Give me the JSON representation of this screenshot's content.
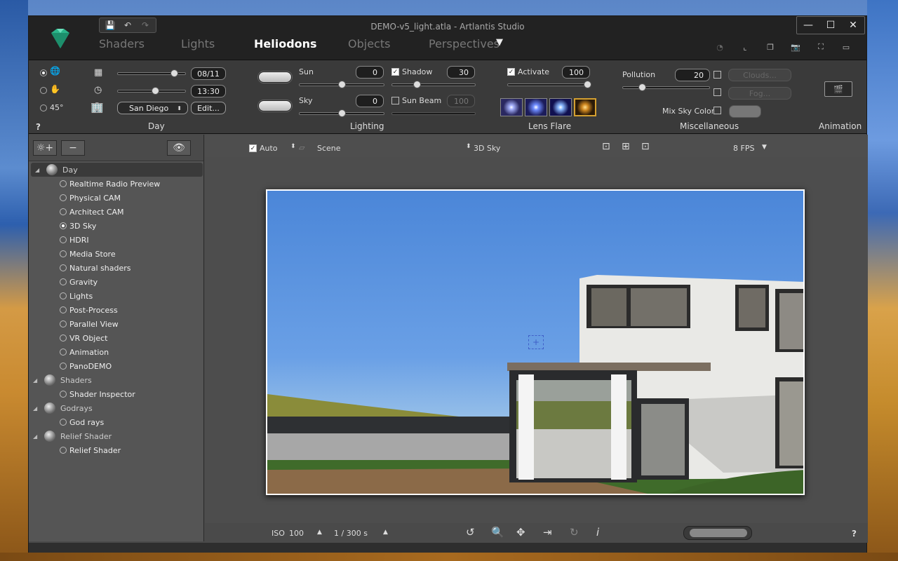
{
  "window": {
    "title": "DEMO-v5_light.atla - Artlantis Studio",
    "controls": {
      "minimize": "—",
      "maximize": "☐",
      "close": "✕"
    }
  },
  "quick_access": [
    "save-icon",
    "undo-icon",
    "redo-icon"
  ],
  "tabs": [
    {
      "label": "Shaders",
      "active": false
    },
    {
      "label": "Lights",
      "active": false
    },
    {
      "label": "Heliodons",
      "active": true
    },
    {
      "label": "Objects",
      "active": false
    },
    {
      "label": "Perspectives",
      "active": false
    }
  ],
  "toolbar_icons": [
    "timer-icon",
    "axis-icon",
    "window-icon",
    "camera-icon",
    "crop-icon",
    "monitor-icon"
  ],
  "day": {
    "label": "Day",
    "date": "08/11",
    "time": "13:30",
    "city": "San Diego",
    "edit_label": "Edit...",
    "angle_label": "45°",
    "date_slider": 0.85,
    "time_slider": 0.55
  },
  "lighting": {
    "label": "Lighting",
    "sun_label": "Sun",
    "sun_value": "0",
    "sky_label": "Sky",
    "sky_value": "0",
    "shadow_label": "Shadow",
    "shadow_checked": true,
    "shadow_value": "30",
    "sunbeam_label": "Sun Beam",
    "sunbeam_checked": false,
    "sunbeam_value": "100"
  },
  "lens_flare": {
    "label": "Lens Flare",
    "activate_label": "Activate",
    "activate_checked": true,
    "value": "100"
  },
  "misc": {
    "label": "Miscellaneous",
    "pollution_label": "Pollution",
    "pollution_value": "20",
    "clouds_label": "Clouds...",
    "fog_label": "Fog...",
    "mix_sky_label": "Mix Sky Color"
  },
  "animation": {
    "label": "Animation"
  },
  "help_label": "?",
  "tree": [
    {
      "label": "Day",
      "type": "group",
      "selected": true
    },
    {
      "label": "Realtime Radio Preview",
      "type": "item",
      "on": false
    },
    {
      "label": "Physical CAM",
      "type": "item",
      "on": false
    },
    {
      "label": "Architect CAM",
      "type": "item",
      "on": false
    },
    {
      "label": "3D Sky",
      "type": "item",
      "on": true
    },
    {
      "label": "HDRI",
      "type": "item",
      "on": false
    },
    {
      "label": "Media Store",
      "type": "item",
      "on": false
    },
    {
      "label": "Natural shaders",
      "type": "item",
      "on": false
    },
    {
      "label": "Gravity",
      "type": "item",
      "on": false
    },
    {
      "label": "Lights",
      "type": "item",
      "on": false
    },
    {
      "label": "Post-Process",
      "type": "item",
      "on": false
    },
    {
      "label": "Parallel View",
      "type": "item",
      "on": false
    },
    {
      "label": "VR Object",
      "type": "item",
      "on": false
    },
    {
      "label": "Animation",
      "type": "item",
      "on": false
    },
    {
      "label": "PanoDEMO",
      "type": "item",
      "on": false
    },
    {
      "label": "Shaders",
      "type": "group",
      "selected": false
    },
    {
      "label": "Shader Inspector",
      "type": "item",
      "on": false
    },
    {
      "label": "Godrays",
      "type": "group",
      "selected": false
    },
    {
      "label": "God rays",
      "type": "item",
      "on": false
    },
    {
      "label": "Relief Shader",
      "type": "group",
      "selected": false
    },
    {
      "label": "Relief Shader",
      "type": "item",
      "on": false
    }
  ],
  "viewbar": {
    "auto_label": "Auto",
    "scene_label": "Scene",
    "sky_label": "3D Sky",
    "fps_label": "8 FPS"
  },
  "bottombar": {
    "iso_label": "ISO",
    "iso_value": "100",
    "shutter_label": "1 /  300 s",
    "help": "?"
  }
}
